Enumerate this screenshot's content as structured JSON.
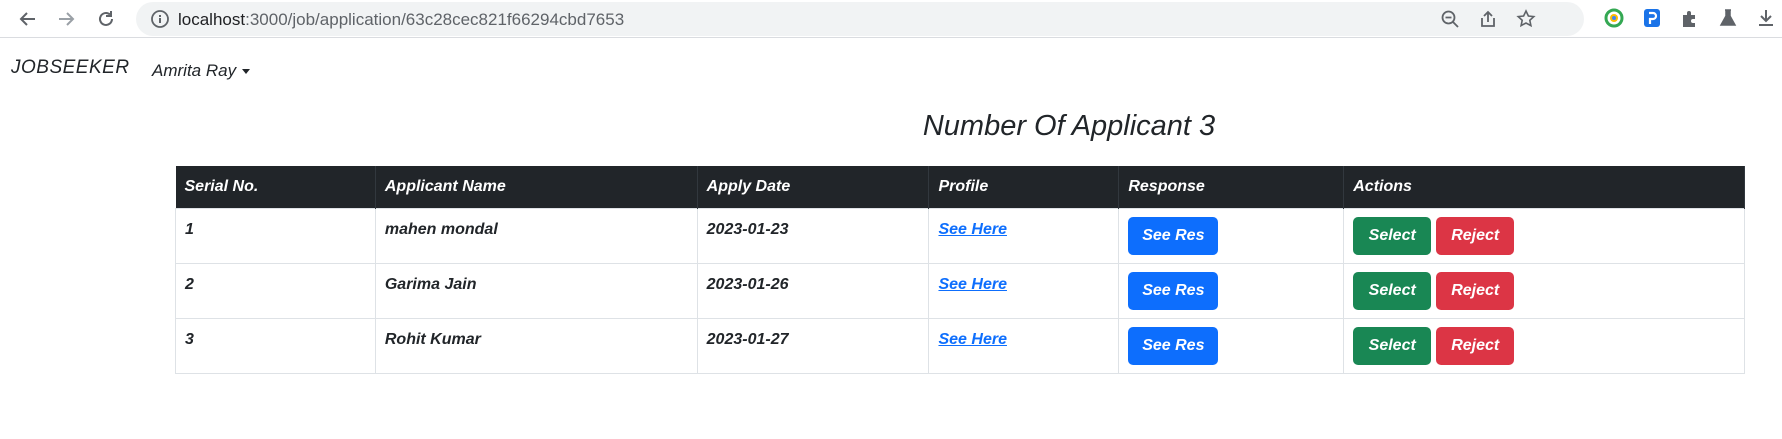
{
  "browser": {
    "url_host": "localhost",
    "url_path": ":3000/job/application/63c28cec821f66294cbd7653"
  },
  "navbar": {
    "brand": "JOBSEEKER",
    "user": "Amrita Ray"
  },
  "page": {
    "title": "Number Of Applicant 3"
  },
  "table": {
    "headers": [
      "Serial No.",
      "Applicant Name",
      "Apply Date",
      "Profile",
      "Response",
      "Actions"
    ],
    "rows": [
      {
        "serial": "1",
        "name": "mahen mondal",
        "date": "2023-01-23",
        "profile": "See Here",
        "response": "See Res",
        "select": "Select",
        "reject": "Reject"
      },
      {
        "serial": "2",
        "name": "Garima Jain",
        "date": "2023-01-26",
        "profile": "See Here",
        "response": "See Res",
        "select": "Select",
        "reject": "Reject"
      },
      {
        "serial": "3",
        "name": "Rohit Kumar",
        "date": "2023-01-27",
        "profile": "See Here",
        "response": "See Res",
        "select": "Select",
        "reject": "Reject"
      }
    ]
  },
  "colors": {
    "header_bg": "#212529",
    "primary": "#0d6efd",
    "success": "#198754",
    "danger": "#dc3545"
  }
}
